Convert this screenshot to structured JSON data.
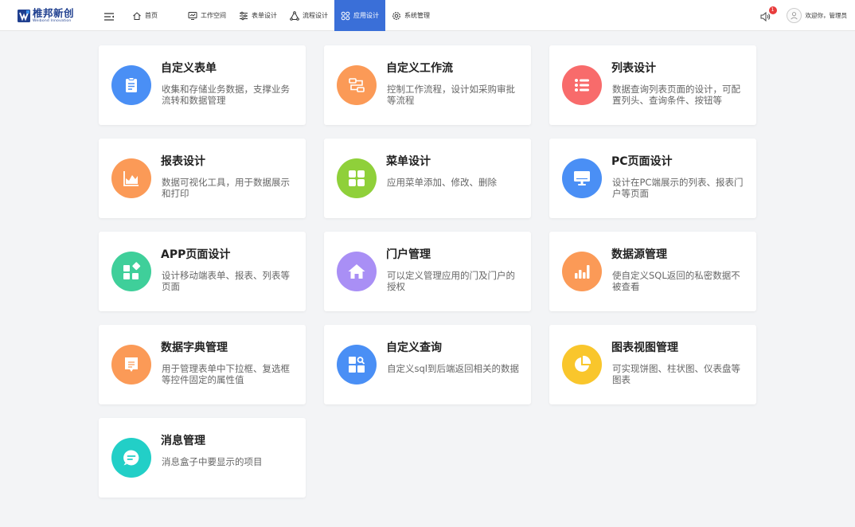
{
  "logo": {
    "name": "椎邦新创",
    "sub": "Weibond Innovation"
  },
  "nav": [
    {
      "label": "首页",
      "icon": "home-icon"
    },
    {
      "label": "工作空间",
      "icon": "monitor-icon"
    },
    {
      "label": "表单设计",
      "icon": "sliders-icon"
    },
    {
      "label": "流程设计",
      "icon": "flow-icon"
    },
    {
      "label": "应用设计",
      "icon": "apps-icon",
      "active": true
    },
    {
      "label": "系统管理",
      "icon": "gear-icon"
    }
  ],
  "header": {
    "notification_count": "1",
    "welcome": "欢迎你，管理员"
  },
  "cards": [
    {
      "title": "自定义表单",
      "desc": "收集和存储业务数据，支撑业务流转和数据管理",
      "color": "#4a8ff5",
      "icon": "clipboard-icon"
    },
    {
      "title": "自定义工作流",
      "desc": "控制工作流程，设计如采购审批等流程",
      "color": "#fb9a57",
      "icon": "workflow-icon"
    },
    {
      "title": "列表设计",
      "desc": "数据查询列表页面的设计，可配置列头、查询条件、按钮等",
      "color": "#f86b6b",
      "icon": "list-icon"
    },
    {
      "title": "报表设计",
      "desc": "数据可视化工具，用于数据展示和打印",
      "color": "#fb9a57",
      "icon": "area-chart-icon"
    },
    {
      "title": "菜单设计",
      "desc": "应用菜单添加、修改、删除",
      "color": "#8fd03a",
      "icon": "grid-icon"
    },
    {
      "title": "PC页面设计",
      "desc": "设计在PC端展示的列表、报表门户等页面",
      "color": "#4a8ff5",
      "icon": "desktop-icon"
    },
    {
      "title": "APP页面设计",
      "desc": "设计移动端表单、报表、列表等页面",
      "color": "#3fcf9a",
      "icon": "widgets-icon"
    },
    {
      "title": "门户管理",
      "desc": "可以定义管理应用的门及门户的授权",
      "color": "#a98ff5",
      "icon": "house-icon"
    },
    {
      "title": "数据源管理",
      "desc": "使自定义SQL返回的私密数据不被查看",
      "color": "#fb9a57",
      "icon": "bar-chart-icon"
    },
    {
      "title": "数据字典管理",
      "desc": "用于管理表单中下拉框、复选框等控件固定的属性值",
      "color": "#fb9a57",
      "icon": "dictionary-icon"
    },
    {
      "title": "自定义查询",
      "desc": "自定义sql到后端返回相关的数据",
      "color": "#4a8ff5",
      "icon": "query-icon"
    },
    {
      "title": "图表视图管理",
      "desc": "可实现饼图、柱状图、仪表盘等图表",
      "color": "#f9c62c",
      "icon": "pie-chart-icon"
    },
    {
      "title": "消息管理",
      "desc": "消息盒子中要显示的项目",
      "color": "#22cfc7",
      "icon": "message-icon"
    }
  ]
}
